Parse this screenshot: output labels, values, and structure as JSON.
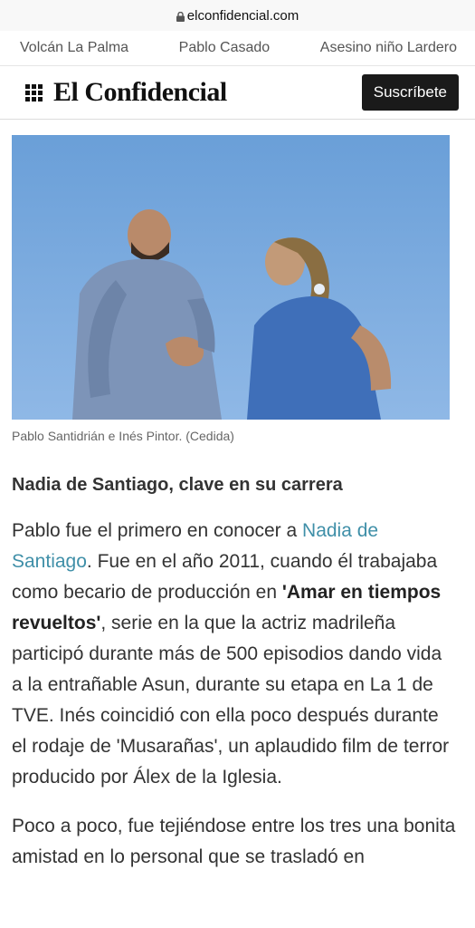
{
  "browser": {
    "url": "elconfidencial.com"
  },
  "trending": [
    "Volcán La Palma",
    "Pablo Casado",
    "Asesino niño Lardero"
  ],
  "header": {
    "logo": "El Confidencial",
    "subscribe_label": "Suscríbete"
  },
  "photo": {
    "caption": "Pablo Santidrián e Inés Pintor. (Cedida)"
  },
  "article": {
    "subhead": "Nadia de Santiago, clave en su carrera",
    "p1": {
      "t1": "Pablo fue el primero en conocer a ",
      "link": "Nadia de Santiago",
      "t2": ". Fue en el año 2011, cuando él trabajaba como becario de producción en ",
      "bold": "'Amar en tiempos revueltos'",
      "t3": ", serie en la que la actriz madrileña participó durante más de 500 episodios dando vida a la entrañable Asun, durante su etapa en La 1 de TVE. Inés coincidió con ella poco después durante el rodaje de 'Musarañas', un aplaudido film de terror producido por Álex de la Iglesia."
    },
    "p2": "Poco a poco, fue tejiéndose entre los tres una bonita amistad en lo personal que se trasladó en"
  },
  "icons": [
    "lock-icon",
    "menu-grid-icon"
  ]
}
